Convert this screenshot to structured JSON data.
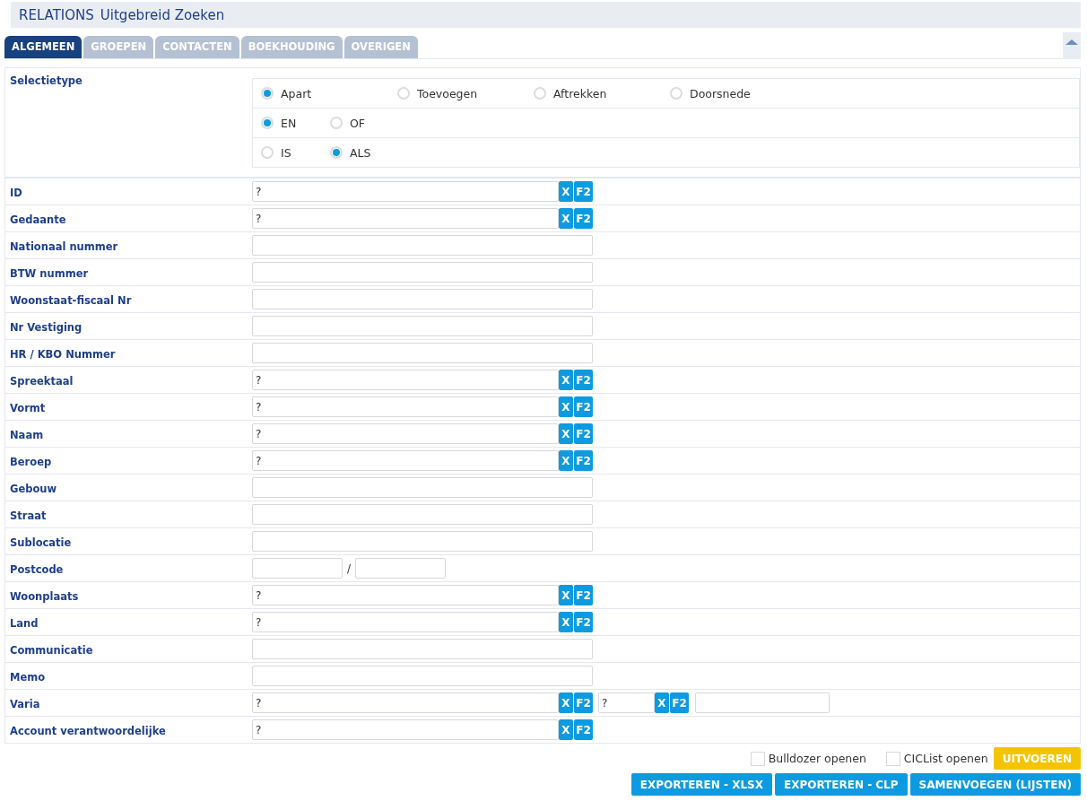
{
  "header": {
    "module": "RELATIONS",
    "title": "Uitgebreid Zoeken"
  },
  "tabs": [
    {
      "label": "ALGEMEEN",
      "selected": true
    },
    {
      "label": "GROEPEN",
      "selected": false
    },
    {
      "label": "CONTACTEN",
      "selected": false
    },
    {
      "label": "BOEKHOUDING",
      "selected": false
    },
    {
      "label": "OVERIGEN",
      "selected": false
    }
  ],
  "selection": {
    "label": "Selectietype",
    "groups": [
      [
        {
          "label": "Apart",
          "selected": true
        },
        {
          "label": "Toevoegen",
          "selected": false
        },
        {
          "label": "Aftrekken",
          "selected": false
        },
        {
          "label": "Doorsnede",
          "selected": false
        }
      ],
      [
        {
          "label": "EN",
          "selected": true
        },
        {
          "label": "OF",
          "selected": false
        }
      ],
      [
        {
          "label": "IS",
          "selected": false
        },
        {
          "label": "ALS",
          "selected": true
        }
      ]
    ]
  },
  "fields": [
    {
      "label": "ID",
      "inputs": [
        {
          "kind": "lookup",
          "value": "?",
          "buttons": [
            "X",
            "F2"
          ]
        }
      ]
    },
    {
      "label": "Gedaante",
      "inputs": [
        {
          "kind": "lookup",
          "value": "?",
          "buttons": [
            "X",
            "F2"
          ]
        }
      ]
    },
    {
      "label": "Nationaal nummer",
      "inputs": [
        {
          "kind": "text"
        }
      ]
    },
    {
      "label": "BTW nummer",
      "inputs": [
        {
          "kind": "text"
        }
      ]
    },
    {
      "label": "Woonstaat-fiscaal Nr",
      "inputs": [
        {
          "kind": "text"
        }
      ]
    },
    {
      "label": "Nr Vestiging",
      "inputs": [
        {
          "kind": "text"
        }
      ]
    },
    {
      "label": "HR / KBO Nummer",
      "inputs": [
        {
          "kind": "text"
        }
      ]
    },
    {
      "label": "Spreektaal",
      "inputs": [
        {
          "kind": "lookup",
          "value": "?",
          "buttons": [
            "X",
            "F2"
          ]
        }
      ]
    },
    {
      "label": "Vormt",
      "inputs": [
        {
          "kind": "lookup",
          "value": "?",
          "buttons": [
            "X",
            "F2"
          ]
        }
      ]
    },
    {
      "label": "Naam",
      "inputs": [
        {
          "kind": "lookup",
          "value": "?",
          "buttons": [
            "X",
            "F2"
          ]
        }
      ]
    },
    {
      "label": "Beroep",
      "inputs": [
        {
          "kind": "lookup",
          "value": "?",
          "buttons": [
            "X",
            "F2"
          ]
        }
      ]
    },
    {
      "label": "Gebouw",
      "inputs": [
        {
          "kind": "text"
        }
      ]
    },
    {
      "label": "Straat",
      "inputs": [
        {
          "kind": "text"
        }
      ]
    },
    {
      "label": "Sublocatie",
      "inputs": [
        {
          "kind": "text"
        }
      ]
    },
    {
      "label": "Postcode",
      "inputs": [
        {
          "kind": "short"
        },
        {
          "kind": "separator",
          "text": "/"
        },
        {
          "kind": "short"
        }
      ]
    },
    {
      "label": "Woonplaats",
      "inputs": [
        {
          "kind": "lookup",
          "value": "?",
          "buttons": [
            "X",
            "F2"
          ]
        }
      ]
    },
    {
      "label": "Land",
      "inputs": [
        {
          "kind": "lookup",
          "value": "?",
          "buttons": [
            "X",
            "F2"
          ]
        }
      ]
    },
    {
      "label": "Communicatie",
      "inputs": [
        {
          "kind": "text"
        }
      ]
    },
    {
      "label": "Memo",
      "inputs": [
        {
          "kind": "text"
        }
      ]
    },
    {
      "label": "Varia",
      "inputs": [
        {
          "kind": "lookup",
          "value": "?",
          "buttons": [
            "X",
            "F2"
          ]
        },
        {
          "kind": "small-lookup",
          "value": "?",
          "buttons": [
            "X",
            "F2"
          ]
        },
        {
          "kind": "medium"
        }
      ]
    },
    {
      "label": "Account verantwoordelijke",
      "inputs": [
        {
          "kind": "lookup",
          "value": "?",
          "buttons": [
            "X",
            "F2"
          ]
        }
      ]
    }
  ],
  "options": [
    {
      "label": "Bulldozer openen",
      "checked": false
    },
    {
      "label": "CICList openen",
      "checked": false
    }
  ],
  "run_button": "UITVOEREN",
  "actions": [
    "EXPORTEREN - XLSX",
    "EXPORTEREN - CLP",
    "SAMENVOEGEN (LIJSTEN)"
  ]
}
